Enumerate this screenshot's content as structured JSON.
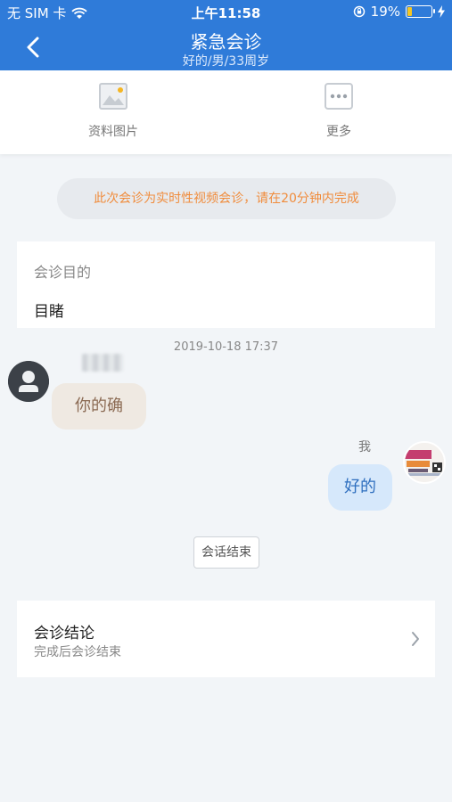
{
  "status_bar": {
    "carrier": "无 SIM 卡",
    "time": "上午11:58",
    "battery": "19%",
    "battery_level": 0.19
  },
  "nav": {
    "title": "紧急会诊",
    "subtitle": "好的/男/33周岁"
  },
  "toolbar": {
    "items": [
      {
        "label": "资料图片",
        "icon": "image-icon"
      },
      {
        "label": "更多",
        "icon": "more-icon"
      }
    ]
  },
  "notice": "此次会诊为实时性视频会诊，请在20分钟内完成",
  "purpose": {
    "label": "会诊目的",
    "value": "目睹"
  },
  "chat": {
    "timestamp": "2019-10-18 17:37",
    "messages": [
      {
        "side": "left",
        "text": "你的确"
      },
      {
        "side": "right",
        "sender": "我",
        "text": "好的"
      }
    ],
    "end_label": "会话结束"
  },
  "conclusion": {
    "title": "会诊结论",
    "subtitle": "完成后会诊结束"
  },
  "colors": {
    "primary": "#2f7bd9",
    "notice": "#f08c3c",
    "bubble_left": "#efe9e2",
    "bubble_right": "#d6e8fb"
  }
}
